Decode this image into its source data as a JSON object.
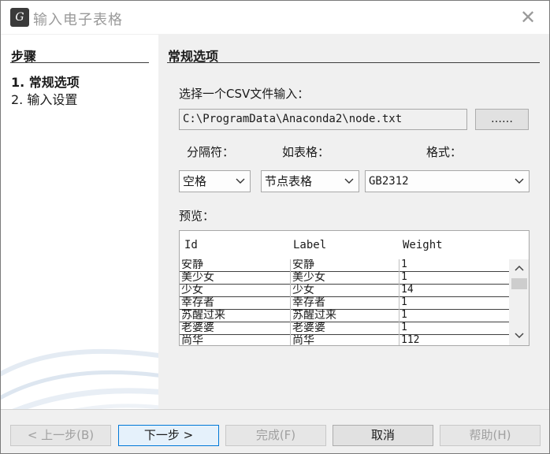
{
  "window": {
    "title": "输入电子表格",
    "icon": "app-logo-icon",
    "close_icon": "close-icon"
  },
  "steps_panel": {
    "heading": "步骤",
    "items": [
      {
        "label": "1. 常规选项",
        "active": true
      },
      {
        "label": "2. 输入设置",
        "active": false
      }
    ]
  },
  "main": {
    "heading": "常规选项",
    "csv_label": "选择一个CSV文件输入：",
    "file_path": "C:\\ProgramData\\Anaconda2\\node.txt",
    "browse_label": "……",
    "separator": {
      "label": "分隔符：",
      "value": "空格"
    },
    "table_type": {
      "label": "如表格：",
      "value": "节点表格"
    },
    "format": {
      "label": "格式：",
      "value": "GB2312"
    },
    "preview": {
      "label": "预览：",
      "columns": [
        "Id",
        "Label",
        "Weight"
      ],
      "rows": [
        [
          "安静",
          "安静",
          "1"
        ],
        [
          "美少女",
          "美少女",
          "1"
        ],
        [
          "少女",
          "少女",
          "14"
        ],
        [
          "幸存者",
          "幸存者",
          "1"
        ],
        [
          "苏醒过来",
          "苏醒过来",
          "1"
        ],
        [
          "老婆婆",
          "老婆婆",
          "1"
        ],
        [
          "尚华",
          "尚华",
          "112"
        ]
      ]
    }
  },
  "buttons": {
    "back": "< 上一步(B)",
    "next": "下一步 >",
    "finish": "完成(F)",
    "cancel": "取消",
    "help": "帮助(H)"
  },
  "colors": {
    "focus_border": "#0078d7",
    "panel_bg": "#f0f0f0",
    "disabled_text": "#a0a0a0"
  }
}
